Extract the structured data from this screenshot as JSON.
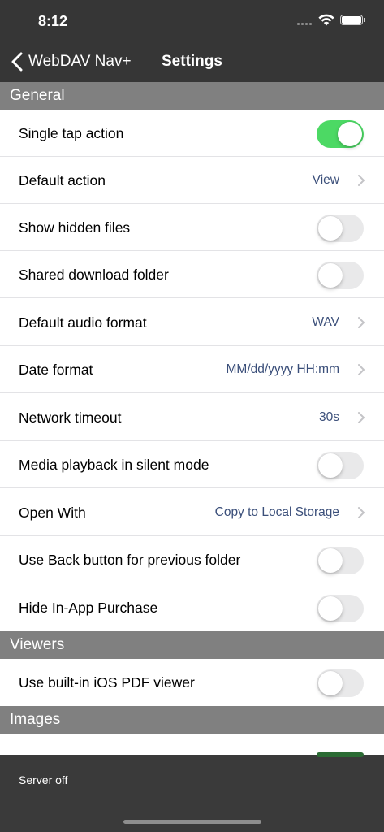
{
  "status_bar": {
    "time": "8:12"
  },
  "nav": {
    "back_label": "WebDAV Nav+",
    "title": "Settings"
  },
  "sections": {
    "general": "General",
    "viewers": "Viewers",
    "images": "Images"
  },
  "rows": {
    "single_tap": {
      "label": "Single tap action",
      "on": true
    },
    "default_action": {
      "label": "Default action",
      "value": "View"
    },
    "show_hidden": {
      "label": "Show hidden files",
      "on": false
    },
    "shared_download": {
      "label": "Shared download folder",
      "on": false
    },
    "audio_format": {
      "label": "Default audio format",
      "value": "WAV"
    },
    "date_format": {
      "label": "Date format",
      "value": "MM/dd/yyyy HH:mm"
    },
    "network_timeout": {
      "label": "Network timeout",
      "value": "30s"
    },
    "media_silent": {
      "label": "Media playback in silent mode",
      "on": false
    },
    "open_with": {
      "label": "Open With",
      "value": "Copy to Local Storage"
    },
    "back_button": {
      "label": "Use Back button for previous folder",
      "on": false
    },
    "hide_iap": {
      "label": "Hide In-App Purchase",
      "on": false
    },
    "pdf_viewer": {
      "label": "Use built-in iOS PDF viewer",
      "on": false
    }
  },
  "bottom_bar": {
    "server_status": "Server off"
  },
  "colors": {
    "toggle_on": "#4cd964",
    "bar_dark": "#363636",
    "section_header": "#808080",
    "value_text": "#3b4f7a"
  },
  "icons": [
    "back-chevron-icon",
    "disclosure-chevron-icon",
    "wifi-icon",
    "battery-icon",
    "cellular-signal-icon"
  ]
}
